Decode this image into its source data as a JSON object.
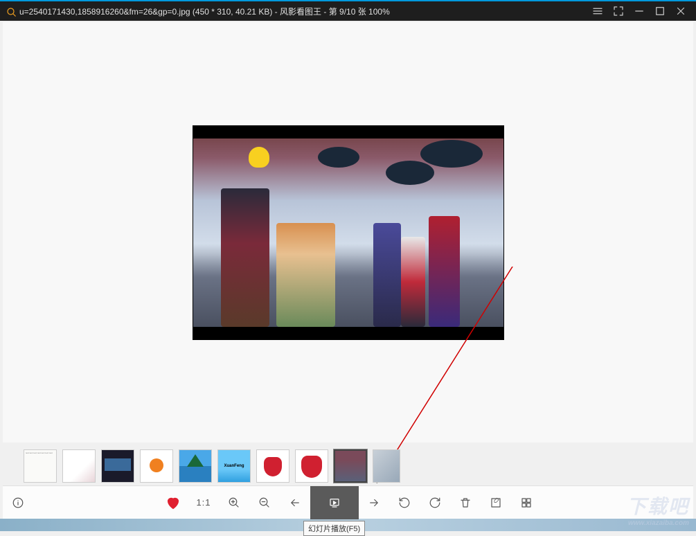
{
  "titlebar": {
    "filename": "u=2540171430,1858916260&fm=26&gp=0.jpg",
    "dimensions": "(450 * 310, 40.21 KB)",
    "app_name": "风影看图王",
    "position": "第 9/10 张 100%"
  },
  "thumbnails": [
    {
      "kind": "text-doc",
      "selected": false
    },
    {
      "kind": "anime-girl",
      "selected": false
    },
    {
      "kind": "dark-screenshot",
      "selected": false
    },
    {
      "kind": "orange-blob",
      "selected": false
    },
    {
      "kind": "beach-umbrella",
      "selected": false
    },
    {
      "kind": "xuanfeng-logo",
      "selected": false
    },
    {
      "kind": "strawberry-1",
      "selected": false
    },
    {
      "kind": "strawberry-2",
      "selected": false
    },
    {
      "kind": "anime-group",
      "selected": true
    },
    {
      "kind": "partial",
      "selected": false
    }
  ],
  "toolbar": {
    "info": "",
    "favorite": "",
    "one_to_one": "1:1",
    "zoom_in": "",
    "zoom_out": "",
    "prev": "",
    "slideshow": "",
    "slideshow_tooltip": "幻灯片播放(F5)",
    "next": "",
    "rotate_ccw": "",
    "rotate_cw": "",
    "delete": "",
    "edit": "",
    "grid": ""
  },
  "watermark": {
    "main": "下载吧",
    "sub": "www.xiazaiba.com"
  }
}
